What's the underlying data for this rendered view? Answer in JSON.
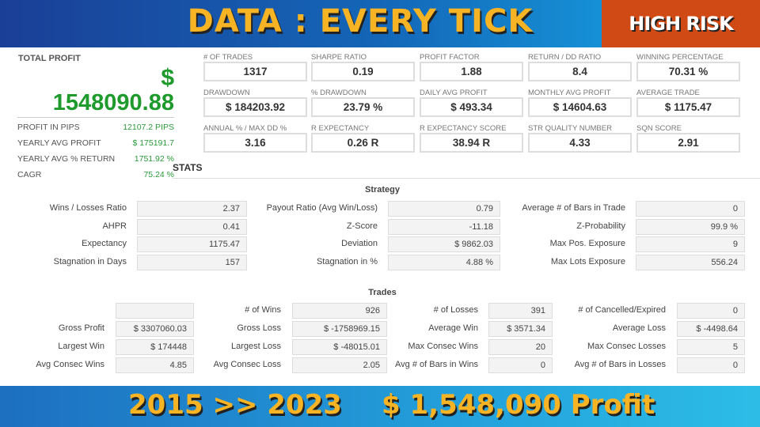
{
  "header": {
    "title": "DATA : EVERY TICK",
    "badge": "HIGH RISK"
  },
  "total_profit": {
    "label": "TOTAL PROFIT",
    "currency": "$",
    "value": "1548090.88",
    "rows": [
      {
        "label": "PROFIT IN PIPS",
        "value": "12107.2 PIPS"
      },
      {
        "label": "YEARLY AVG PROFIT",
        "value": "$ 175191.7"
      },
      {
        "label": "YEARLY AVG % RETURN",
        "value": "1751.92 %"
      },
      {
        "label": "CAGR",
        "value": "75.24 %"
      }
    ]
  },
  "stats_heading": "STATS",
  "cards": [
    {
      "label": "# OF TRADES",
      "value": "1317"
    },
    {
      "label": "SHARPE RATIO",
      "value": "0.19"
    },
    {
      "label": "PROFIT FACTOR",
      "value": "1.88"
    },
    {
      "label": "RETURN / DD RATIO",
      "value": "8.4"
    },
    {
      "label": "WINNING PERCENTAGE",
      "value": "70.31 %"
    },
    {
      "label": "DRAWDOWN",
      "value": "$ 184203.92"
    },
    {
      "label": "% DRAWDOWN",
      "value": "23.79 %"
    },
    {
      "label": "DAILY AVG PROFIT",
      "value": "$ 493.34"
    },
    {
      "label": "MONTHLY AVG PROFIT",
      "value": "$ 14604.63"
    },
    {
      "label": "AVERAGE TRADE",
      "value": "$ 1175.47"
    },
    {
      "label": "ANNUAL % / MAX DD %",
      "value": "3.16"
    },
    {
      "label": "R EXPECTANCY",
      "value": "0.26 R"
    },
    {
      "label": "R EXPECTANCY SCORE",
      "value": "38.94 R"
    },
    {
      "label": "STR QUALITY NUMBER",
      "value": "4.33"
    },
    {
      "label": "SQN SCORE",
      "value": "2.91"
    }
  ],
  "strategy": {
    "title": "Strategy",
    "rows": [
      [
        {
          "label": "Wins / Losses Ratio",
          "value": "2.37"
        },
        {
          "label": "Payout Ratio (Avg Win/Loss)",
          "value": "0.79"
        },
        {
          "label": "Average # of Bars in Trade",
          "value": "0"
        }
      ],
      [
        {
          "label": "AHPR",
          "value": "0.41"
        },
        {
          "label": "Z-Score",
          "value": "-11.18"
        },
        {
          "label": "Z-Probability",
          "value": "99.9 %"
        }
      ],
      [
        {
          "label": "Expectancy",
          "value": "1175.47"
        },
        {
          "label": "Deviation",
          "value": "$ 9862.03"
        },
        {
          "label": "Max Pos. Exposure",
          "value": "9"
        }
      ],
      [
        {
          "label": "Stagnation in Days",
          "value": "157"
        },
        {
          "label": "Stagnation in %",
          "value": "4.88 %"
        },
        {
          "label": "Max Lots Exposure",
          "value": "556.24"
        }
      ]
    ]
  },
  "trades": {
    "title": "Trades",
    "rows": [
      [
        {
          "label": "",
          "value": ""
        },
        {
          "label": "# of Wins",
          "value": "926"
        },
        {
          "label": "# of Losses",
          "value": "391"
        },
        {
          "label": "# of Cancelled/Expired",
          "value": "0"
        }
      ],
      [
        {
          "label": "Gross Profit",
          "value": "$ 3307060.03"
        },
        {
          "label": "Gross Loss",
          "value": "$ -1758969.15"
        },
        {
          "label": "Average Win",
          "value": "$ 3571.34"
        },
        {
          "label": "Average Loss",
          "value": "$ -4498.64"
        }
      ],
      [
        {
          "label": "Largest Win",
          "value": "$ 174448"
        },
        {
          "label": "Largest Loss",
          "value": "$ -48015.01"
        },
        {
          "label": "Max Consec Wins",
          "value": "20"
        },
        {
          "label": "Max Consec Losses",
          "value": "5"
        }
      ],
      [
        {
          "label": "Avg Consec Wins",
          "value": "4.85"
        },
        {
          "label": "Avg Consec Loss",
          "value": "2.05"
        },
        {
          "label": "Avg # of Bars in Wins",
          "value": "0"
        },
        {
          "label": "Avg # of Bars in Losses",
          "value": "0"
        }
      ]
    ]
  },
  "footer": {
    "period": "2015 >> 2023",
    "profit": "$ 1,548,090 Profit"
  }
}
